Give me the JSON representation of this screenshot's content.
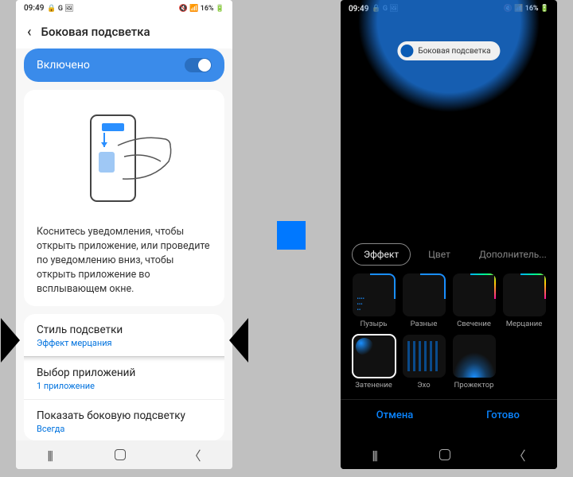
{
  "status": {
    "time": "09:49",
    "icons_left": "🔒 G 🖼",
    "icons_right": "🔇 📶 16% 🔋",
    "battery_pct": "16%"
  },
  "left": {
    "title": "Боковая подсветка",
    "enabled_label": "Включено",
    "description": "Коснитесь уведомления, чтобы открыть приложение, или проведите по уведомлению вниз, чтобы открыть приложение во всплывающем окне.",
    "items": [
      {
        "title": "Стиль подсветки",
        "subtitle": "Эффект мерцания"
      },
      {
        "title": "Выбор приложений",
        "subtitle": "1 приложение"
      },
      {
        "title": "Показать боковую подсветку",
        "subtitle": "Всегда"
      }
    ]
  },
  "right": {
    "pill_label": "Боковая подсветка",
    "tabs": [
      "Эффект",
      "Цвет",
      "Дополнитель..."
    ],
    "active_tab": 0,
    "effects": [
      {
        "label": "Пузырь",
        "kind": "bubble corner-blue"
      },
      {
        "label": "Разные",
        "kind": "corner-blue"
      },
      {
        "label": "Свечение",
        "kind": "corner-rainbow"
      },
      {
        "label": "Мерцание",
        "kind": "corner-rainbow"
      },
      {
        "label": "Затенение",
        "kind": "shade",
        "selected": true
      },
      {
        "label": "Эхо",
        "kind": "echo"
      },
      {
        "label": "Прожектор",
        "kind": "shade-proj"
      }
    ],
    "cancel": "Отмена",
    "done": "Готово"
  }
}
